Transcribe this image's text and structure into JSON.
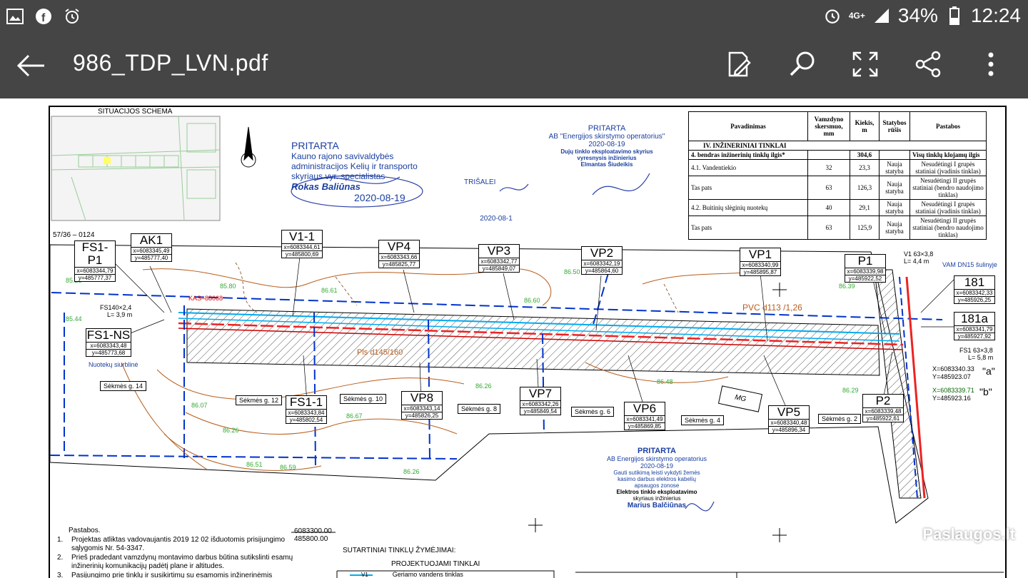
{
  "status_bar": {
    "battery": "34%",
    "time": "12:24",
    "network": "4G+"
  },
  "app_bar": {
    "title": "986_TDP_LVN.pdf",
    "actions": [
      "edit-icon",
      "search-icon",
      "fullscreen-icon",
      "share-icon",
      "more-icon"
    ]
  },
  "drawing": {
    "situation_title": "SITUACIJOS SCHEMA",
    "map_id": "57/36 – 0124",
    "stamp1": {
      "line1": "PRITARTA",
      "line2": "Kauno rajono savivaldybės",
      "line3": "administracijos Kelių ir transporto",
      "line4": "skyriaus vyr. specialistas",
      "name": "Rokas Baliūnas",
      "date": "2020-08-19"
    },
    "stamp2": {
      "head": "TRIŠALEI",
      "date": "2020-08-1"
    },
    "stamp3": {
      "line1": "PRITARTA",
      "line2": "AB \"Energijos skirstymo operatorius\"",
      "date": "2020-08-19",
      "line3": "Dujų tinklo eksploatavimo skyrius",
      "line4": "vyresnysis inžinierius",
      "name": "Elmantas Šiudeikis"
    },
    "stamp4": {
      "line1": "PRITARTA",
      "line2": "AB Energijos skirstymo operatorius",
      "date": "2020-08-19",
      "line3": "Gauti sutikimą leisti vykdyti žemės",
      "line4": "kasimo darbus elektros kabelių",
      "line5": "apsaugos zonose",
      "line6": "Elektros tinklo eksploatavimo",
      "line7": "skyriaus inžinierius",
      "name": "Marius Balčiūnas"
    },
    "table": {
      "headers": [
        "Pavadinimas",
        "Vamzdyno skersmuo, mm",
        "Kiekis, m",
        "Statybos rūšis",
        "Pastabos"
      ],
      "section": "IV. INŽINERINIAI TINKLAI",
      "rows": [
        [
          "4. bendras inžinerinių tinklų ilgis*",
          "",
          "304,6",
          "",
          "Visų tinklų klojamų ilgis"
        ],
        [
          "4.1. Vandentiekio",
          "32",
          "23,3",
          "Nauja statyba",
          "Nesudėtingi I grupės statiniai (įvadinis tinklas)"
        ],
        [
          "Tas pats",
          "63",
          "126,3",
          "Nauja statyba",
          "Nesudėtingi II grupės statiniai (bendro naudojimo tinklas)"
        ],
        [
          "4.2. Buitinių slėginių nuotekų",
          "40",
          "29,1",
          "Nauja statyba",
          "Nesudėtingi I grupės statiniai (įvadinis tinklas)"
        ],
        [
          "Tas pats",
          "63",
          "125,9",
          "Nauja statyba",
          "Nesudėtingi II grupės statiniai (bendro naudojimo tinklas)"
        ]
      ]
    },
    "points": [
      {
        "name": "FS1-P1",
        "x": "x=6083344,79",
        "y": "y=485777,37"
      },
      {
        "name": "AK1",
        "x": "x=6083345,49",
        "y": "y=485777,40"
      },
      {
        "name": "V1-1",
        "x": "x=6083344,61",
        "y": "y=485800,69"
      },
      {
        "name": "VP4",
        "x": "x=6083343,66",
        "y": "y=485825,77"
      },
      {
        "name": "VP3",
        "x": "x=6083342,77",
        "y": "y=485849,07"
      },
      {
        "name": "VP2",
        "x": "x=6083342,19",
        "y": "y=485864,60"
      },
      {
        "name": "VP1",
        "x": "x=6083340,99",
        "y": "y=485895,87"
      },
      {
        "name": "P1",
        "x": "x=6083339,98",
        "y": "y=485922,52"
      },
      {
        "name": "181",
        "x": "x=6083342,33",
        "y": "y=485926,25"
      },
      {
        "name": "181a",
        "x": "x=6083341,79",
        "y": "y=485927,92"
      },
      {
        "name": "FS1-NS",
        "x": "x=6083343,48",
        "y": "y=485773,68"
      },
      {
        "name": "FS1-1",
        "x": "x=6083343,84",
        "y": "y=485802,54"
      },
      {
        "name": "VP8",
        "x": "x=6083343,14",
        "y": "y=485826,25"
      },
      {
        "name": "VP7",
        "x": "x=6083342,26",
        "y": "y=485849,54"
      },
      {
        "name": "VP6",
        "x": "x=6083341,49",
        "y": "y=485869,85"
      },
      {
        "name": "VP5",
        "x": "x=6083340,48",
        "y": "y=485896,34"
      },
      {
        "name": "P2",
        "x": "x=6083339,48",
        "y": "y=485922,61"
      }
    ],
    "streets": [
      "Sėkmės g. 14",
      "Sėkmės g. 12",
      "Sėkmės g. 10",
      "Sėkmės g. 8",
      "Sėkmės g. 6",
      "Sėkmės g. 4",
      "Sėkmės g. 2"
    ],
    "labels": {
      "kas": "KAS–88068",
      "fs140": "FS140×2,4",
      "fs140_len": "L= 3,9 m",
      "v1_63": "V1 63×3,8",
      "v1_63_len": "L= 4,4 m",
      "vam": "VAM DN15 šulinyje",
      "fs1_63": "FS1 63×3,8",
      "fs1_63_len": "L= 5,8 m",
      "pvc": "PVC d113 /1,26",
      "pls": "Pls d145/160",
      "nuoteku": "Nuotekų siurblinė",
      "mg": "MG",
      "pt_a_x": "X=6083340.33",
      "pt_a_y": "Y=485923.07",
      "pt_a": "\"a\"",
      "pt_b_x": "X=6083339.71",
      "pt_b_y": "Y=485923.16",
      "pt_b": "\"b\"",
      "coord1": "6083300.00",
      "coord2": "485800.00"
    },
    "notes": {
      "title": "Pastabos.",
      "n1": "Projektas atliktas vadovaujantis 2019 12 02 išduotomis prisijungimo",
      "n1b": "sąlygomis Nr. 54-3347.",
      "n2": "Prieš pradedant vamzdynų montavimo darbus būtina sutikslinti esamų",
      "n2b": "inžinerinių komunikacijų padėtį plane ir altitudes.",
      "n3": "Pasijungimo prie tinklų ir susikirtimų su esamomis inžinerinėmis"
    },
    "legend": {
      "title": "SUTARTINIAI TINKLŲ ŽYMĖJIMAI:",
      "sub": "PROJEKTUOJAMI TINKLAI",
      "v1": "V1",
      "v1_label": "Geriamo vandens tinklas"
    }
  },
  "watermark": "Paslaugos.lt"
}
